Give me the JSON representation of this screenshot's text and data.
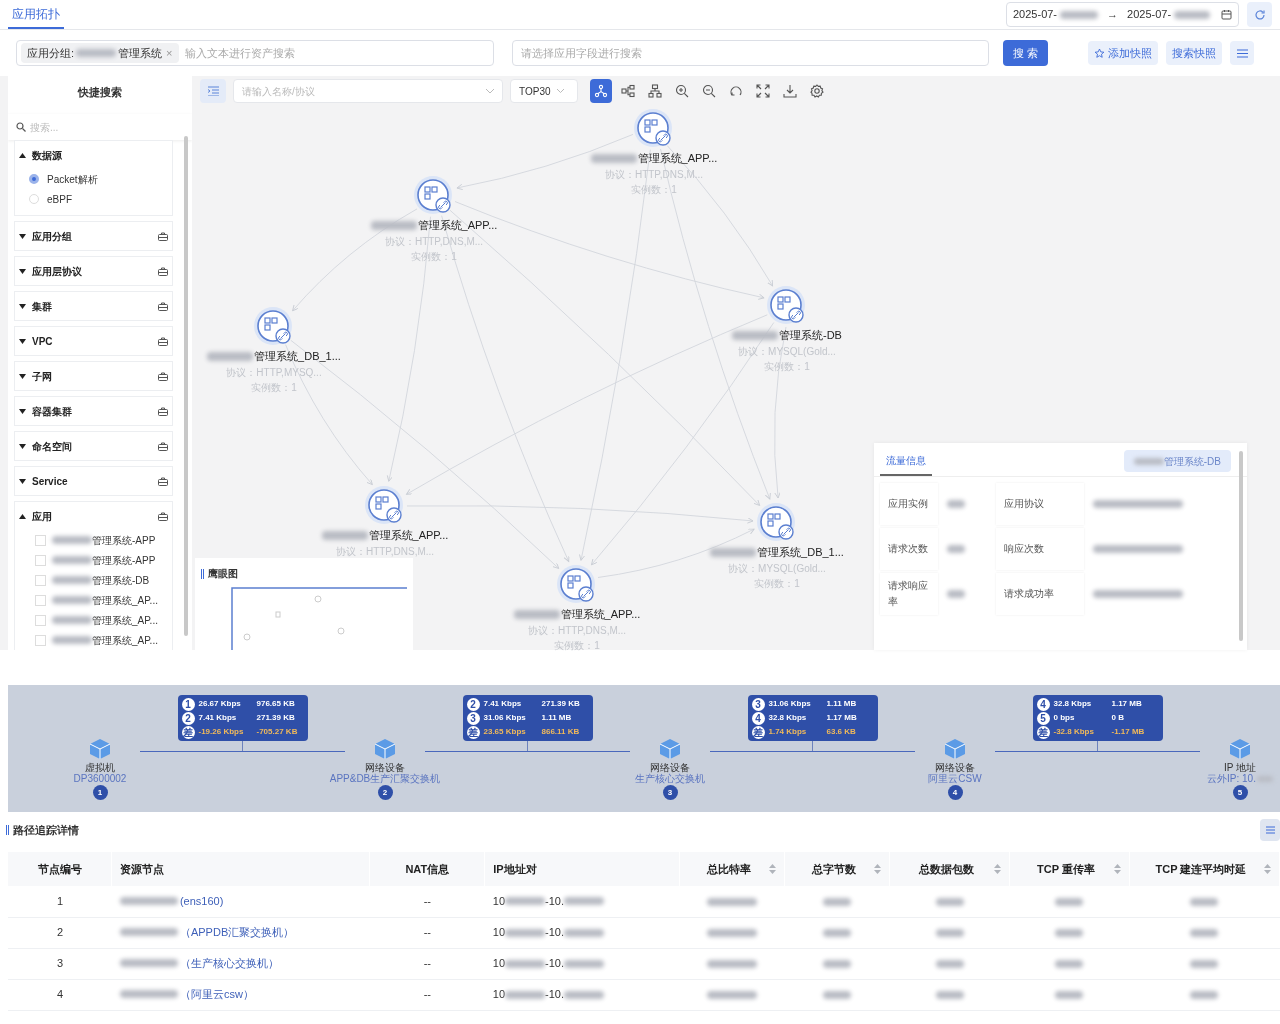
{
  "header": {
    "tabs": [
      {
        "label": "应用拓扑",
        "selected": true
      }
    ],
    "date_start": "2025-07-",
    "date_separator": "→",
    "date_end": "2025-07-"
  },
  "filter": {
    "tag_label": "应用分组:",
    "tag_value": "管理系统",
    "tag_remove": "×",
    "placeholder": "输入文本进行资产搜索"
  },
  "field_search": {
    "placeholder": "请选择应用字段进行搜索"
  },
  "buttons": {
    "search": "搜 索",
    "add_snapshot": "添加快照",
    "snapshots": "搜索快照"
  },
  "sidebar": {
    "title": "快捷搜索",
    "search_placeholder": "搜索...",
    "sections": [
      {
        "label": "数据源",
        "expanded": true,
        "kind": "radio",
        "options": [
          {
            "label": "Packet解析",
            "selected": true
          },
          {
            "label": "eBPF",
            "selected": false
          }
        ]
      },
      {
        "label": "应用分组",
        "expanded": false
      },
      {
        "label": "应用层协议",
        "expanded": false
      },
      {
        "label": "集群",
        "expanded": false
      },
      {
        "label": "VPC",
        "expanded": false
      },
      {
        "label": "子网",
        "expanded": false
      },
      {
        "label": "容器集群",
        "expanded": false
      },
      {
        "label": "命名空间",
        "expanded": false
      },
      {
        "label": "Service",
        "expanded": false
      },
      {
        "label": "应用",
        "expanded": true,
        "kind": "checkbox",
        "options": [
          {
            "label": "管理系统-APP",
            "checked": false
          },
          {
            "label": "管理系统-APP",
            "checked": false
          },
          {
            "label": "管理系统-DB",
            "checked": false
          },
          {
            "label": "管理系统_AP...",
            "checked": false
          },
          {
            "label": "管理系统_AP...",
            "checked": false
          },
          {
            "label": "管理系统_AP...",
            "checked": false
          }
        ]
      }
    ]
  },
  "toolbar": {
    "name_placeholder": "请输入名称/协议",
    "top": "TOP30",
    "tools": [
      {
        "kind": "network",
        "selected": true
      },
      {
        "kind": "tree",
        "selected": false
      },
      {
        "kind": "hierarchy",
        "selected": false
      },
      {
        "kind": "zoom-in",
        "selected": false
      },
      {
        "kind": "zoom-out",
        "selected": false
      },
      {
        "kind": "reset",
        "selected": false
      },
      {
        "kind": "fullscreen",
        "selected": false
      },
      {
        "kind": "download",
        "selected": false
      },
      {
        "kind": "settings",
        "selected": false
      }
    ]
  },
  "graph": {
    "nodes": [
      {
        "name": "管理系统_APP...",
        "protocol": "协议：HTTP,DNS,M...",
        "instances": "实例数：1"
      },
      {
        "name": "管理系统_APP...",
        "protocol": "协议：HTTP,DNS,M...",
        "instances": "实例数：1"
      },
      {
        "name": "管理系统_DB_1...",
        "protocol": "协议：HTTP,MYSQ...",
        "instances": "实例数：1"
      },
      {
        "name": "管理系统-DB",
        "protocol": "协议：MYSQL(Gold...",
        "instances": "实例数：1"
      },
      {
        "name": "管理系统_APP...",
        "protocol": "协议：HTTP,DNS,M..."
      },
      {
        "name": "管理系统_APP...",
        "protocol": "协议：HTTP,DNS,M...",
        "instances": "实例数：1"
      },
      {
        "name": "管理系统_DB_1...",
        "protocol": "协议：MYSQL(Gold...",
        "instances": "实例数：1"
      }
    ]
  },
  "minimap": {
    "title": "鹰眼图"
  },
  "flow_panel": {
    "tabs": [
      {
        "label": "流量信息",
        "selected": true
      }
    ],
    "app": "管理系统-DB",
    "labels": [
      "应用实例",
      "应用协议",
      "请求次数",
      "响应次数",
      "请求响应率",
      "请求成功率"
    ]
  },
  "path": {
    "nodes": [
      {
        "type": "虚拟机",
        "name": "DP3600002",
        "number": "1",
        "name_cut": false
      },
      {
        "type": "网络设备",
        "name": "APP&DB生产汇聚交换机",
        "number": "2",
        "name_cut": false
      },
      {
        "type": "网络设备",
        "name": "生产核心交换机",
        "number": "3",
        "name_cut": false
      },
      {
        "type": "网络设备",
        "name": "阿里云CSW",
        "number": "4",
        "name_cut": false
      },
      {
        "type": "IP 地址",
        "name": "云外IP: 10.",
        "number": "5",
        "name_cut": true
      }
    ],
    "links": [
      {
        "rows": [
          {
            "kind": "hop",
            "index": "1",
            "rate": "26.67 Kbps",
            "bytes": "976.65 KB"
          },
          {
            "kind": "hop",
            "index": "2",
            "rate": "7.41 Kbps",
            "bytes": "271.39 KB"
          },
          {
            "kind": "diff",
            "index": "差",
            "rate": "-19.26 Kbps",
            "bytes": "-705.27 KB"
          }
        ]
      },
      {
        "rows": [
          {
            "kind": "hop",
            "index": "2",
            "rate": "7.41 Kbps",
            "bytes": "271.39 KB"
          },
          {
            "kind": "hop",
            "index": "3",
            "rate": "31.06 Kbps",
            "bytes": "1.11 MB"
          },
          {
            "kind": "diff",
            "index": "差",
            "rate": "23.65 Kbps",
            "bytes": "866.11 KB"
          }
        ]
      },
      {
        "rows": [
          {
            "kind": "hop",
            "index": "3",
            "rate": "31.06 Kbps",
            "bytes": "1.11 MB"
          },
          {
            "kind": "hop",
            "index": "4",
            "rate": "32.8 Kbps",
            "bytes": "1.17 MB"
          },
          {
            "kind": "diff",
            "index": "差",
            "rate": "1.74 Kbps",
            "bytes": "63.6 KB"
          }
        ]
      },
      {
        "rows": [
          {
            "kind": "hop",
            "index": "4",
            "rate": "32.8 Kbps",
            "bytes": "1.17 MB"
          },
          {
            "kind": "hop",
            "index": "5",
            "rate": "0 bps",
            "bytes": "0 B"
          },
          {
            "kind": "diff",
            "index": "差",
            "rate": "-32.8 Kbps",
            "bytes": "-1.17 MB"
          }
        ]
      }
    ]
  },
  "trace": {
    "title": "路径追踪详情",
    "columns": [
      {
        "label": "节点编号",
        "sortable": false
      },
      {
        "label": "资源节点",
        "sortable": false
      },
      {
        "label": "NAT信息",
        "sortable": false
      },
      {
        "label": "IP地址对",
        "sortable": false
      },
      {
        "label": "总比特率",
        "sortable": true
      },
      {
        "label": "总字节数",
        "sortable": true
      },
      {
        "label": "总数据包数",
        "sortable": true
      },
      {
        "label": "TCP 重传率",
        "sortable": true
      },
      {
        "label": "TCP 建连平均时延",
        "sortable": true
      }
    ],
    "rows": [
      {
        "no": "1",
        "resource": "(ens160)",
        "nat": "--",
        "ip": [
          "10",
          "-10."
        ]
      },
      {
        "no": "2",
        "resource": "（APPDB汇聚交换机）",
        "nat": "--",
        "ip": [
          "10",
          "-10."
        ]
      },
      {
        "no": "3",
        "resource": "（生产核心交换机）",
        "nat": "--",
        "ip": [
          "10",
          "-10."
        ]
      },
      {
        "no": "4",
        "resource": "（阿里云csw）",
        "nat": "--",
        "ip": [
          "10",
          "-10."
        ]
      }
    ]
  }
}
